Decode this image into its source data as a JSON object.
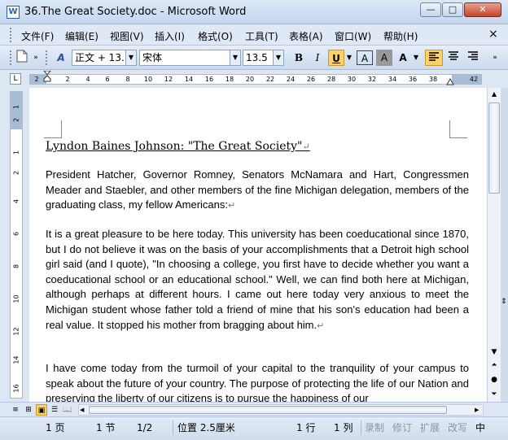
{
  "window": {
    "title": "36.The Great Society.doc - Microsoft Word",
    "app_icon": "W",
    "controls": {
      "minimize": "—",
      "maximize": "□",
      "close": "✕"
    }
  },
  "menu": {
    "items": [
      "文件(F)",
      "编辑(E)",
      "视图(V)",
      "插入(I)",
      "格式(O)",
      "工具(T)",
      "表格(A)",
      "窗口(W)",
      "帮助(H)"
    ],
    "close_doc": "×"
  },
  "toolbar": {
    "style_value": "正文 + 13.",
    "font_value": "宋体",
    "size_value": "13.5",
    "bold": "B",
    "italic": "I",
    "underline": "U",
    "char_border": "A",
    "char_shading": "A",
    "highlight": "A",
    "active_color": "#fbd26a"
  },
  "ruler": {
    "corner": "L",
    "ticks": [
      "2",
      "2",
      "4",
      "6",
      "8",
      "10",
      "12",
      "14",
      "16",
      "18",
      "20",
      "22",
      "24",
      "26",
      "28",
      "30",
      "32",
      "34",
      "36",
      "38",
      "42"
    ],
    "vticks": [
      "1",
      "2",
      "1",
      "2",
      "4",
      "6",
      "8",
      "10",
      "12",
      "14",
      "16"
    ]
  },
  "document": {
    "title": "Lyndon Baines Johnson: \"The Great Society\"",
    "paragraph_mark": "↵",
    "paragraphs": [
      "President Hatcher, Governor Romney, Senators McNamara and Hart, Congressmen Meader and Staebler, and other members of the fine Michigan delegation, members of the graduating class, my fellow Americans:",
      "It is a great pleasure to be here today. This university has been coeducational since 1870, but I do not believe it was on the basis of your accomplishments that a Detroit high school girl said (and I quote), \"In choosing a college, you first have to decide whether you want a coeducational school or an educational school.\" Well, we can find both here at Michigan, although perhaps at different hours. I came out here today very anxious to meet the Michigan student whose father told a friend of mine that his son's education had been a real value. It stopped his mother from bragging about him.",
      "I have come today from the turmoil of your capital to the tranquility of your campus to speak about the future of your country. The purpose of protecting the life of our Nation and preserving the liberty of our citizens is to pursue the happiness of our"
    ]
  },
  "status": {
    "page": "1 页",
    "section": "1 节",
    "page_of": "1/2",
    "position": "位置 2.5厘米",
    "line": "1 行",
    "column": "1 列",
    "rec": "录制",
    "trk": "修订",
    "ext": "扩展",
    "ovr": "改写",
    "lang": "中"
  }
}
